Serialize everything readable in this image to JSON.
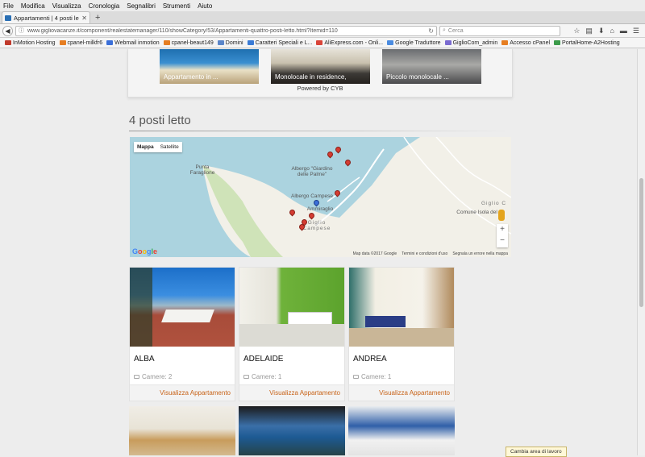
{
  "menu": [
    "File",
    "Modifica",
    "Visualizza",
    "Cronologia",
    "Segnalibri",
    "Strumenti",
    "Aiuto"
  ],
  "tab": {
    "title": "Appartamenti | 4 posti le..."
  },
  "url": "www.gigliovacanze.it/component/realestatemanager/110/showCategory/53/Appartamenti-quattro-posti-letto.html?Itemid=110",
  "search_placeholder": "Cerca",
  "bookmarks": [
    "InMotion Hosting",
    "cpanel-milkfr6",
    "Webmail inmotion",
    "cpanel-beaut149",
    "Domini",
    "Caratteri Speciali e L...",
    "AliExpress.com - Onli...",
    "Google Traduttore",
    "GiglioCom_admin",
    "Accesso cPanel",
    "PortalHome-A2Hosting"
  ],
  "bookmark_colors": [
    "#c0392b",
    "#e67e22",
    "#3b6fd8",
    "#e67e22",
    "#5b86c9",
    "#3a7bd5",
    "#d9453a",
    "#4a8be0",
    "#7a6bd1",
    "#e67e22",
    "#3c9b4a"
  ],
  "featured": [
    "Appartamento in ...",
    "Monolocale in residence,",
    "Piccolo monolocale ..."
  ],
  "powered": "Powered by CYB",
  "section_title": "4 posti letto",
  "map": {
    "toggle": [
      "Mappa",
      "Satellite"
    ],
    "labels": [
      "Punta Faraglione",
      "Albergo \"Giardino delle Palme\"",
      "Albergo Campese",
      "Ammiraglio",
      "Giglio Campese",
      "Giglio C",
      "Comune Isola del G"
    ],
    "footer": [
      "Map data ©2017 Google",
      "Termini e condizioni d'uso",
      "Segnala un errore nella mappa"
    ],
    "google": "Google"
  },
  "apartments": [
    {
      "name": "ALBA",
      "rooms": "Camere: 2",
      "link": "Visualizza Appartamento"
    },
    {
      "name": "ADELAIDE",
      "rooms": "Camere: 1",
      "link": "Visualizza Appartamento"
    },
    {
      "name": "ANDREA",
      "rooms": "Camere: 1",
      "link": "Visualizza Appartamento"
    }
  ],
  "toast": "Cambia area di lavoro"
}
